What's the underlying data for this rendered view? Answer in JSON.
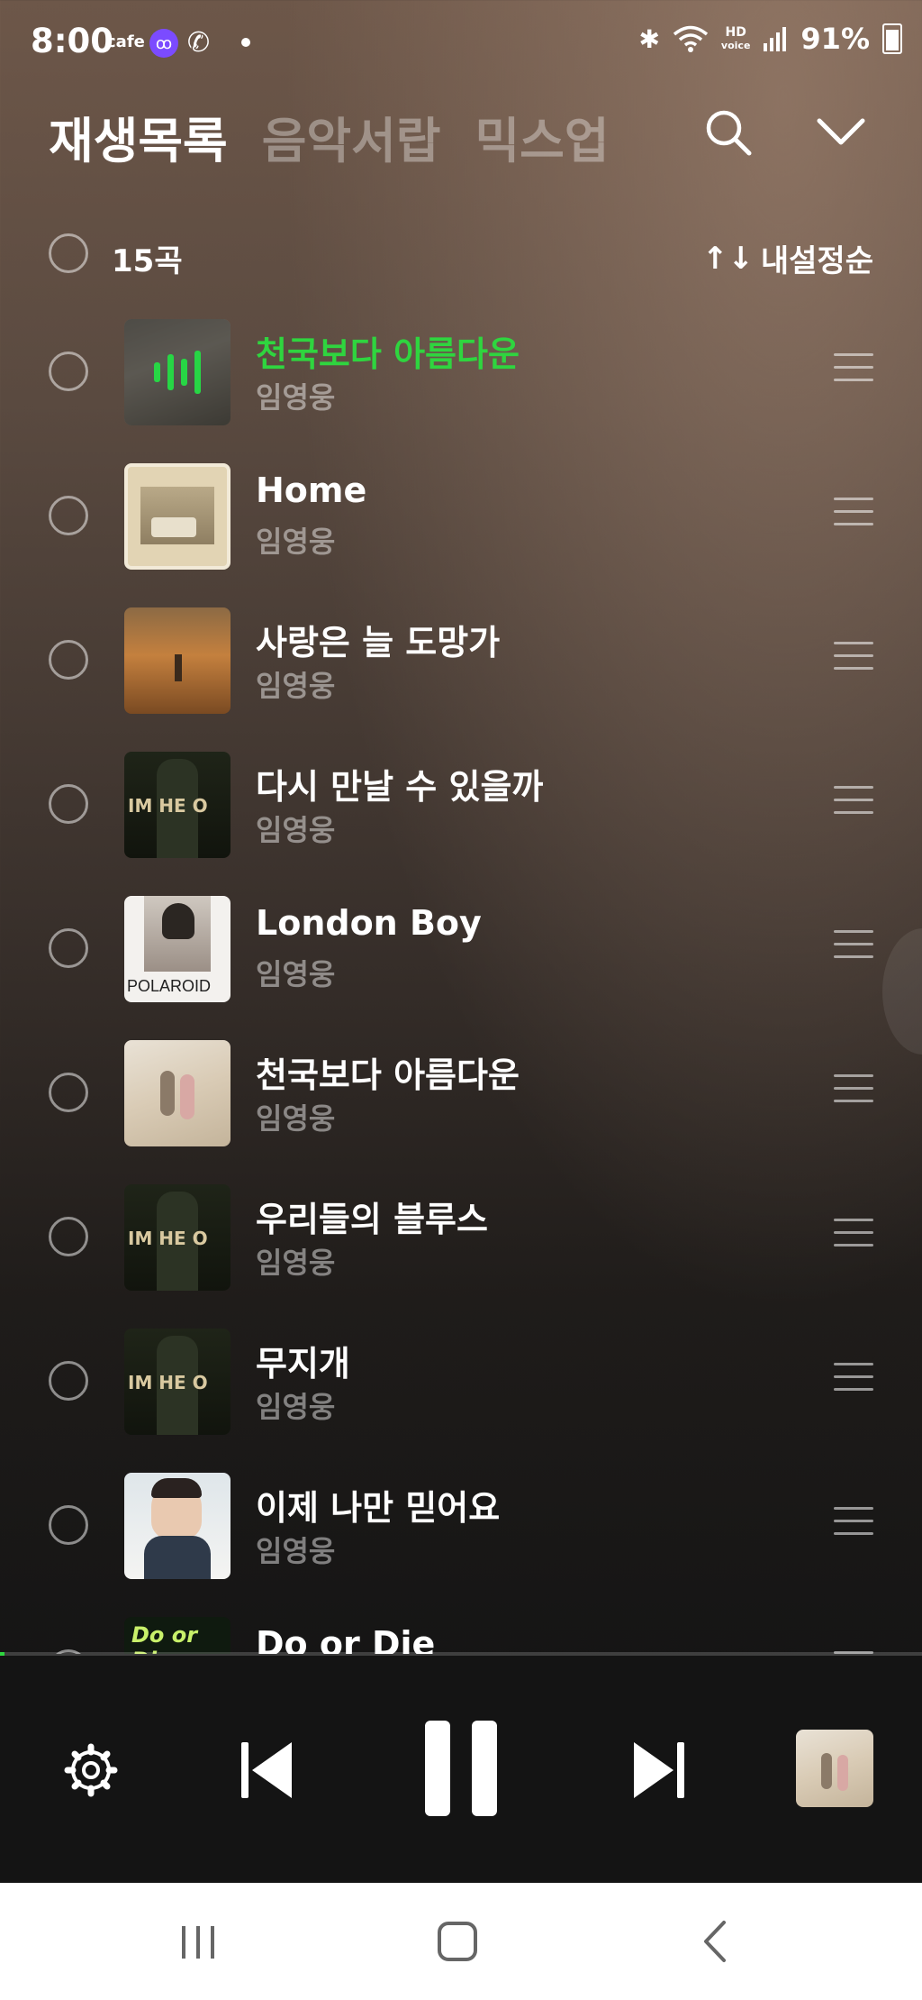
{
  "status_bar": {
    "time": "8:00",
    "cafe": "cafe",
    "app_icon": "ꝏ",
    "battery": "91%",
    "hd": "HD",
    "voice": "voice"
  },
  "header": {
    "tabs": [
      {
        "label": "재생목록",
        "active": true
      },
      {
        "label": "음악서랍",
        "active": false
      },
      {
        "label": "믹스업",
        "active": false
      }
    ],
    "icons": [
      "search-icon",
      "chevron-down-icon"
    ]
  },
  "list_header": {
    "count": "15곡",
    "sort_icon": "↑↓",
    "sort_label": "내설정순"
  },
  "tracks": [
    {
      "title": "천국보다 아름다운",
      "artist": "임영웅",
      "playing": true
    },
    {
      "title": "Home",
      "artist": "임영웅",
      "playing": false
    },
    {
      "title": "사랑은 늘 도망가",
      "artist": "임영웅",
      "playing": false
    },
    {
      "title": "다시 만날 수 있을까",
      "artist": "임영웅",
      "playing": false
    },
    {
      "title": "London Boy",
      "artist": "임영웅",
      "playing": false
    },
    {
      "title": "천국보다 아름다운",
      "artist": "임영웅",
      "playing": false
    },
    {
      "title": "우리들의 블루스",
      "artist": "임영웅",
      "playing": false
    },
    {
      "title": "무지개",
      "artist": "임영웅",
      "playing": false
    },
    {
      "title": "이제 나만 믿어요",
      "artist": "임영웅",
      "playing": false
    },
    {
      "title": "Do or Die",
      "artist": "",
      "playing": false
    }
  ],
  "album_art_text": {
    "hero": "IM HE O",
    "polaroid": "POLAROID",
    "doordie": "Do or Die"
  },
  "player": {
    "progress": 0.005,
    "controls": [
      "settings-icon",
      "previous-icon",
      "pause-icon",
      "next-icon"
    ]
  },
  "colors": {
    "accent": "#2fd53f",
    "background_top": "#6d5749",
    "background_bottom": "#141414"
  },
  "nav": [
    "recent-apps-icon",
    "home-icon",
    "back-icon"
  ]
}
